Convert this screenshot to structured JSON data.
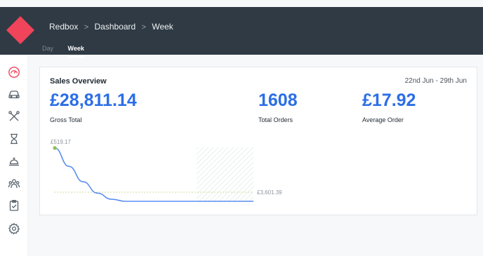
{
  "colors": {
    "topbar": "#2f3a44",
    "brand": "#f0445a",
    "accent": "#2b6ee6",
    "line": "#5b8ef0",
    "start_point": "#8bc34a"
  },
  "breadcrumb": {
    "items": [
      "Redbox",
      "Dashboard",
      "Week"
    ],
    "separator": ">"
  },
  "tabs": [
    {
      "label": "Day",
      "active": false
    },
    {
      "label": "Week",
      "active": true
    }
  ],
  "sidebar": {
    "icons": [
      "speedometer-icon",
      "car-icon",
      "tools-icon",
      "hourglass-icon",
      "service-bell-icon",
      "group-icon",
      "clipboard-check-icon",
      "settings-icon"
    ]
  },
  "card": {
    "title": "Sales Overview",
    "date_range": "22nd Jun - 29th Jun",
    "stats": [
      {
        "value": "£28,811.14",
        "label": "Gross Total"
      },
      {
        "value": "1608",
        "label": "Total Orders"
      },
      {
        "value": "£17.92",
        "label": "Average Order"
      }
    ]
  },
  "chart_data": {
    "type": "line",
    "start_label": "£519.17",
    "end_label": "£3,601.39",
    "series": [
      {
        "values": [
          519.17,
          340,
          190,
          80,
          20,
          0,
          0,
          0,
          0,
          0,
          0,
          0,
          0,
          0,
          0
        ]
      }
    ],
    "reference_line": 3601.39,
    "grid": false
  }
}
